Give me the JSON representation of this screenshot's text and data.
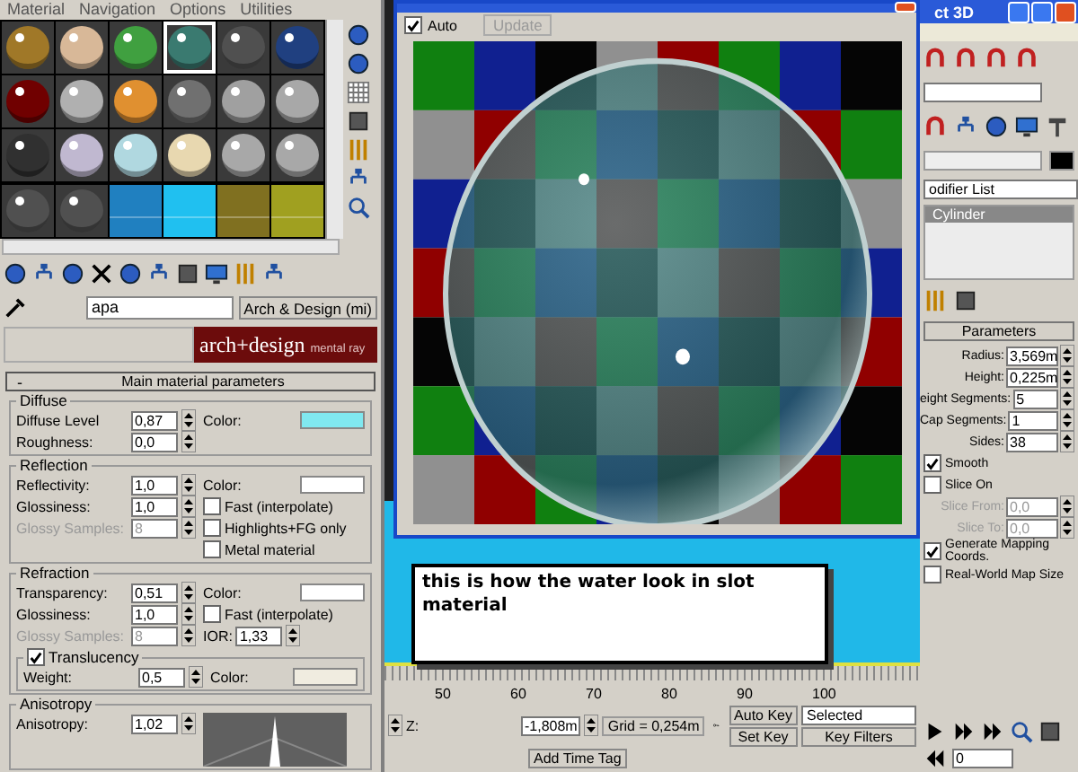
{
  "material_editor": {
    "menu": [
      "Material",
      "Navigation",
      "Options",
      "Utilities"
    ],
    "slots": [
      {
        "kind": "sphere",
        "color": "#a07828",
        "selected": false
      },
      {
        "kind": "sphere",
        "color": "#d8b898",
        "selected": false
      },
      {
        "kind": "sphere",
        "color": "#40a040",
        "selected": false
      },
      {
        "kind": "sphere",
        "color": "#3a7a70",
        "selected": true
      },
      {
        "kind": "sphere",
        "color": "#505050",
        "selected": false
      },
      {
        "kind": "sphere",
        "color": "#204080",
        "selected": false
      },
      {
        "kind": "sphere",
        "color": "#700000",
        "selected": false
      },
      {
        "kind": "sphere",
        "color": "#b0b0b0",
        "selected": false
      },
      {
        "kind": "sphere",
        "color": "#e09030",
        "selected": false
      },
      {
        "kind": "sphere",
        "color": "#707070",
        "selected": false
      },
      {
        "kind": "sphere",
        "color": "#a0a0a0",
        "selected": false
      },
      {
        "kind": "sphere",
        "color": "#a8a8a8",
        "selected": false
      },
      {
        "kind": "sphere",
        "color": "#303030",
        "selected": false
      },
      {
        "kind": "sphere",
        "color": "#c0b8d0",
        "selected": false
      },
      {
        "kind": "sphere",
        "color": "#b0d8e0",
        "selected": false
      },
      {
        "kind": "sphere",
        "color": "#e8d8b0",
        "selected": false
      },
      {
        "kind": "sphere",
        "color": "#a8a8a8",
        "selected": false
      },
      {
        "kind": "sphere",
        "color": "#a8a8a8",
        "selected": false
      },
      {
        "kind": "sphere",
        "color": "#505050",
        "selected": false
      },
      {
        "kind": "sphere",
        "color": "#505050",
        "selected": false
      },
      {
        "kind": "flat",
        "color": "#2080c0",
        "selected": false
      },
      {
        "kind": "flat",
        "color": "#20c0f0",
        "selected": false
      },
      {
        "kind": "flat",
        "color": "#807020",
        "selected": false
      },
      {
        "kind": "flat",
        "color": "#a0a020",
        "selected": false
      }
    ],
    "material_name": "apa",
    "material_type": "Arch & Design (mi)",
    "banner": {
      "title": "arch+design",
      "subtitle": "mental ray"
    },
    "rollout": {
      "toggle": "-",
      "title": "Main material parameters"
    },
    "groups": [
      {
        "title": "Diffuse",
        "fields": [
          {
            "label": "Diffuse Level",
            "value": "0,87",
            "disabled": false
          },
          {
            "label": "Roughness:",
            "value": "0,0",
            "disabled": false
          }
        ],
        "extras": [
          {
            "kind": "color",
            "label": "Color:",
            "color": "#80e8f0"
          }
        ]
      },
      {
        "title": "Reflection",
        "fields": [
          {
            "label": "Reflectivity:",
            "value": "1,0",
            "disabled": false
          },
          {
            "label": "Glossiness:",
            "value": "1,0",
            "disabled": false
          },
          {
            "label": "Glossy Samples:",
            "value": "8",
            "disabled": true
          }
        ],
        "extras": [
          {
            "kind": "color",
            "label": "Color:",
            "color": "#ffffff"
          },
          {
            "kind": "check",
            "label": "Fast (interpolate)",
            "checked": false
          },
          {
            "kind": "check",
            "label": "Highlights+FG only",
            "checked": false
          },
          {
            "kind": "check",
            "label": "Metal material",
            "checked": false
          }
        ]
      },
      {
        "title": "Refraction",
        "fields": [
          {
            "label": "Transparency:",
            "value": "0,51",
            "disabled": false
          },
          {
            "label": "Glossiness:",
            "value": "1,0",
            "disabled": false
          },
          {
            "label": "Glossy Samples:",
            "value": "8",
            "disabled": true
          }
        ],
        "extras": [
          {
            "kind": "color",
            "label": "Color:",
            "color": "#ffffff"
          },
          {
            "kind": "check",
            "label": "Fast (interpolate)",
            "checked": false
          },
          {
            "kind": "spinner",
            "label": "IOR:",
            "value": "1,33"
          }
        ],
        "sub": {
          "label": "Translucency",
          "checked": true,
          "fields": [
            {
              "label": "Weight:",
              "value": "0,5",
              "disabled": false
            }
          ],
          "extras": [
            {
              "kind": "color",
              "label": "Color:",
              "color": "#f0ece0"
            }
          ]
        }
      },
      {
        "title": "Anisotropy",
        "fields": [
          {
            "label": "Anisotropy:",
            "value": "1,02",
            "disabled": false
          }
        ],
        "extras": [
          {
            "kind": "preview"
          }
        ]
      }
    ]
  },
  "render_window": {
    "auto": {
      "label": "Auto",
      "checked": true
    },
    "update": {
      "label": "Update",
      "disabled": true
    }
  },
  "annotation": "this is how the water look in slot material",
  "max_window": {
    "title": "ct 3D",
    "modifier_list": "odifier List",
    "stack": [
      {
        "label": "Cylinder",
        "selected": true
      }
    ],
    "rollout_title": "Parameters",
    "params": [
      {
        "label": "Radius:",
        "value": "3,569m"
      },
      {
        "label": "Height:",
        "value": "0,225m"
      },
      {
        "label": "eight Segments:",
        "value": "5"
      },
      {
        "label": "Cap Segments:",
        "value": "1"
      },
      {
        "label": "Sides:",
        "value": "38"
      }
    ],
    "options": [
      {
        "kind": "check",
        "label": "Smooth",
        "checked": true
      },
      {
        "kind": "check",
        "label": "Slice On",
        "checked": false
      },
      {
        "kind": "spinner",
        "label": "Slice From:",
        "value": "0,0",
        "disabled": true
      },
      {
        "kind": "spinner",
        "label": "Slice To:",
        "value": "0,0",
        "disabled": true
      },
      {
        "kind": "check",
        "label": "Generate Mapping Coords.",
        "checked": true
      },
      {
        "kind": "check",
        "label": "Real-World Map Size",
        "checked": false
      }
    ],
    "frame": "0"
  },
  "timeline": {
    "ticks": [
      "50",
      "60",
      "70",
      "80",
      "90",
      "100"
    ]
  },
  "bottom_bar": {
    "z_label": "Z:",
    "z_value": "-1,808m",
    "grid": "Grid = 0,254m",
    "auto_key": "Auto Key",
    "selection": "Selected",
    "set_key": "Set Key",
    "key_filters": "Key Filters",
    "time_tag": "Add Time Tag"
  }
}
